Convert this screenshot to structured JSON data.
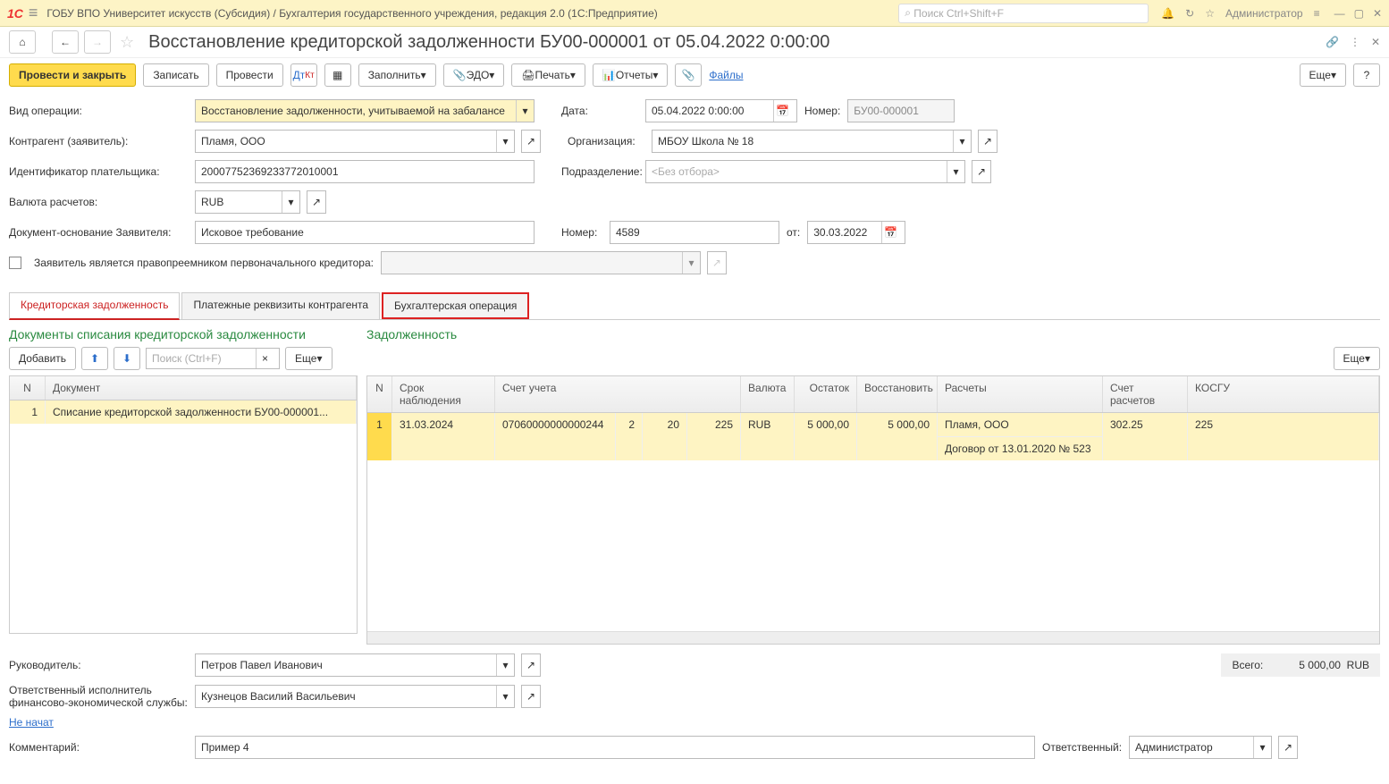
{
  "titlebar": {
    "text": "ГОБУ ВПО Университет искусств (Субсидия) / Бухгалтерия государственного учреждения, редакция 2.0  (1С:Предприятие)",
    "search_placeholder": "Поиск Ctrl+Shift+F",
    "user": "Администратор"
  },
  "doc_title": "Восстановление кредиторской задолженности БУ00-000001 от 05.04.2022 0:00:00",
  "toolbar": {
    "post_close": "Провести и закрыть",
    "save": "Записать",
    "post": "Провести",
    "fill": "Заполнить",
    "edo": "ЭДО",
    "print": "Печать",
    "reports": "Отчеты",
    "files": "Файлы",
    "more": "Еще"
  },
  "form": {
    "op_type_label": "Вид операции:",
    "op_type": "Восстановление задолженности, учитываемой на забалансе",
    "date_label": "Дата:",
    "date": "05.04.2022  0:00:00",
    "number_label": "Номер:",
    "number": "БУ00-000001",
    "contragent_label": "Контрагент (заявитель):",
    "contragent": "Пламя, ООО",
    "org_label": "Организация:",
    "org": "МБОУ Школа № 18",
    "payer_id_label": "Идентификатор плательщика:",
    "payer_id": "20007752369233772010001",
    "dept_label": "Подразделение:",
    "dept_placeholder": "<Без отбора>",
    "currency_label": "Валюта расчетов:",
    "currency": "RUB",
    "basis_label": "Документ-основание Заявителя:",
    "basis": "Исковое требование",
    "basis_num_label": "Номер:",
    "basis_num": "4589",
    "basis_date_label": "от:",
    "basis_date": "30.03.2022",
    "successor_label": "Заявитель является правопреемником первоначального кредитора:"
  },
  "tabs": {
    "t1": "Кредиторская задолженность",
    "t2": "Платежные реквизиты контрагента",
    "t3": "Бухгалтерская операция"
  },
  "sections": {
    "left": "Документы списания кредиторской задолженности",
    "right": "Задолженность"
  },
  "left_toolbar": {
    "add": "Добавить",
    "search_placeholder": "Поиск (Ctrl+F)",
    "more": "Еще"
  },
  "left_grid": {
    "headers": {
      "n": "N",
      "doc": "Документ"
    },
    "rows": [
      {
        "n": "1",
        "doc": "Списание кредиторской задолженности БУ00-000001..."
      }
    ]
  },
  "right_toolbar": {
    "more": "Еще"
  },
  "right_grid": {
    "headers": {
      "n": "N",
      "date": "Срок наблюдения",
      "acct": "Счет учета",
      "curr": "Валюта",
      "bal": "Остаток",
      "restore": "Восстановить",
      "calc": "Расчеты",
      "calc_acct": "Счет расчетов",
      "kosgu": "КОСГУ"
    },
    "rows": [
      {
        "n": "1",
        "date": "31.03.2024",
        "acct": "07060000000000244",
        "a2": "2",
        "a3": "20",
        "a4": "225",
        "curr": "RUB",
        "bal": "5 000,00",
        "restore": "5 000,00",
        "calc1": "Пламя, ООО",
        "calc2": "Договор от 13.01.2020 № 523",
        "calc_acct": "302.25",
        "kosgu": "225"
      }
    ]
  },
  "footer": {
    "manager_label": "Руководитель:",
    "manager": "Петров Павел Иванович",
    "exec_label": "Ответственный исполнитель финансово-экономической службы:",
    "exec": "Кузнецов Василий Васильевич",
    "not_started": "Не начат",
    "comment_label": "Комментарий:",
    "comment": "Пример 4",
    "resp_label": "Ответственный:",
    "resp": "Администратор",
    "total_label": "Всего:",
    "total_value": "5 000,00",
    "total_curr": "RUB"
  }
}
